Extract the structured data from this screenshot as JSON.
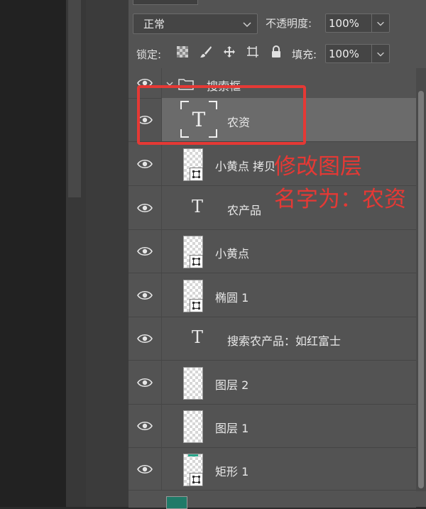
{
  "blend": {
    "mode": "正常",
    "opacity_label": "不透明度:",
    "opacity_value": "100%"
  },
  "lock": {
    "label": "锁定:",
    "fill_label": "填充:",
    "fill_value": "100%"
  },
  "group": {
    "name": "搜索框"
  },
  "layers": [
    {
      "name": "农资",
      "kind": "text",
      "selected": true
    },
    {
      "name": "小黄点 拷贝",
      "kind": "smart"
    },
    {
      "name": "农产品",
      "kind": "text"
    },
    {
      "name": "小黄点",
      "kind": "smart"
    },
    {
      "name": "椭圆 1",
      "kind": "smart"
    },
    {
      "name": "搜索农产品：如红富士",
      "kind": "text"
    },
    {
      "name": "图层 2",
      "kind": "pixel"
    },
    {
      "name": "图层 1",
      "kind": "pixel"
    },
    {
      "name": "矩形 1",
      "kind": "smart"
    }
  ],
  "annotation": {
    "line1": "修改图层",
    "line2": "名字为：农资"
  },
  "colors": {
    "panel": "#535353",
    "selected_row": "#6b6b6b",
    "annotation_red": "#e53935"
  }
}
